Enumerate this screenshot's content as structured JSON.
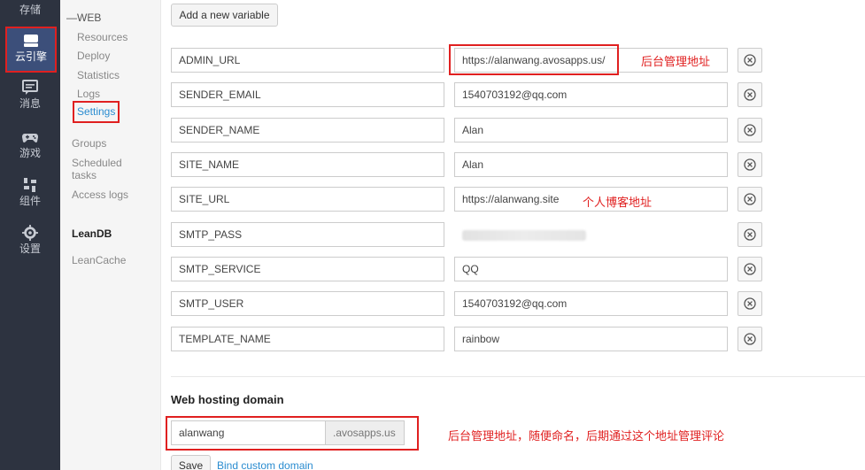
{
  "rail": {
    "items": [
      {
        "label": "存储",
        "icon": "storage-icon"
      },
      {
        "label": "云引擎",
        "icon": "cloud-engine-icon",
        "active": true
      },
      {
        "label": "消息",
        "icon": "message-icon"
      },
      {
        "label": "游戏",
        "icon": "gamepad-icon"
      },
      {
        "label": "组件",
        "icon": "components-icon"
      },
      {
        "label": "设置",
        "icon": "gear-icon"
      }
    ]
  },
  "subnav": {
    "web_head": "WEB",
    "web_items": [
      "Resources",
      "Deploy",
      "Statistics",
      "Logs",
      "Settings"
    ],
    "groups": "Groups",
    "scheduled_line1": "Scheduled",
    "scheduled_line2": "tasks",
    "access_logs": "Access logs",
    "leandb": "LeanDB",
    "leancache": "LeanCache"
  },
  "main": {
    "add_variable_label": "Add a new variable",
    "variables": [
      {
        "name": "ADMIN_URL",
        "value": "https://alanwang.avosapps.us/"
      },
      {
        "name": "SENDER_EMAIL",
        "value": "1540703192@qq.com"
      },
      {
        "name": "SENDER_NAME",
        "value": "Alan"
      },
      {
        "name": "SITE_NAME",
        "value": "Alan"
      },
      {
        "name": "SITE_URL",
        "value": "https://alanwang.site"
      },
      {
        "name": "SMTP_PASS",
        "value": ""
      },
      {
        "name": "SMTP_SERVICE",
        "value": "QQ"
      },
      {
        "name": "SMTP_USER",
        "value": "1540703192@qq.com"
      },
      {
        "name": "TEMPLATE_NAME",
        "value": "rainbow"
      }
    ],
    "annotations": {
      "admin_url_note": "后台管理地址",
      "site_url_note": "个人博客地址",
      "domain_note": "后台管理地址，随便命名，后期通过这个地址管理评论"
    },
    "hosting": {
      "title": "Web hosting domain",
      "subdomain": "alanwang",
      "suffix": ".avosapps.us",
      "save_label": "Save",
      "bind_custom_label": "Bind custom domain"
    }
  },
  "colors": {
    "rail_bg": "#2d3340",
    "active_bg": "#3c4f7a",
    "annotation_red": "#e02020",
    "link_blue": "#2a8cd0"
  }
}
